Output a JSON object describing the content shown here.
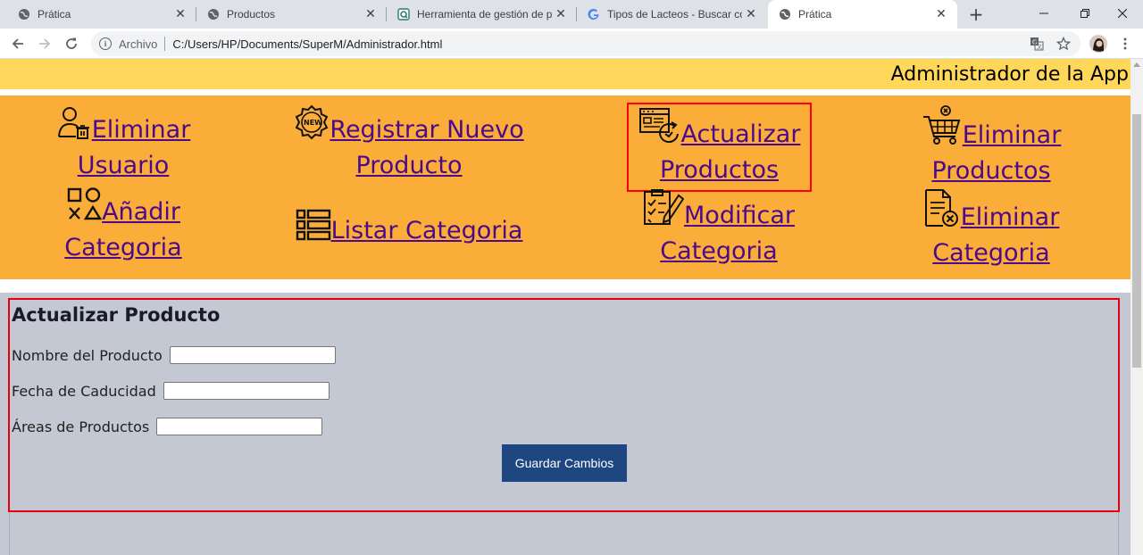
{
  "browser": {
    "tabs": [
      {
        "title": "Prática",
        "favicon": "globe-icon"
      },
      {
        "title": "Productos",
        "favicon": "globe-icon"
      },
      {
        "title": "Herramienta de gestión de pru",
        "favicon": "tool-icon"
      },
      {
        "title": "Tipos de Lacteos - Buscar con G",
        "favicon": "google-icon"
      },
      {
        "title": "Prática",
        "favicon": "globe-icon",
        "active": true
      }
    ],
    "address_scheme": "Archivo",
    "address_url": "C:/Users/HP/Documents/SuperM/Administrador.html"
  },
  "header": {
    "title": "Administrador de la App"
  },
  "menu": {
    "items": [
      {
        "label_1": "Eliminar",
        "label_2": "Usuario",
        "icon": "user-delete-icon"
      },
      {
        "label_1": "Registrar Nuevo",
        "label_2": "Producto",
        "icon": "new-badge-icon"
      },
      {
        "label_1": "Actualizar",
        "label_2": "Productos",
        "icon": "update-products-icon",
        "selected": true
      },
      {
        "label_1": "Eliminar",
        "label_2": "Productos",
        "icon": "cart-delete-icon"
      },
      {
        "label_1": "Añadir",
        "label_2": "Categoria",
        "icon": "shapes-icon"
      },
      {
        "label_1": "Listar Categoria",
        "icon": "list-icon"
      },
      {
        "label_1": "Modificar",
        "label_2": "Categoria",
        "icon": "edit-checklist-icon"
      },
      {
        "label_1": "Eliminar",
        "label_2": "Categoria",
        "icon": "document-delete-icon"
      }
    ]
  },
  "form": {
    "title": "Actualizar Producto",
    "fields": [
      {
        "label": "Nombre del Producto",
        "value": ""
      },
      {
        "label": "Fecha de Caducidad",
        "value": ""
      },
      {
        "label": "Áreas de Productos",
        "value": ""
      }
    ],
    "submit_label": "Guardar Cambios"
  },
  "colors": {
    "header_bg": "#ffd75a",
    "menu_bg": "#fbad3a",
    "link": "#4b0a8c",
    "form_bg": "#c3c8d3",
    "highlight_border": "#e8000b",
    "button_bg": "#1e4680"
  }
}
